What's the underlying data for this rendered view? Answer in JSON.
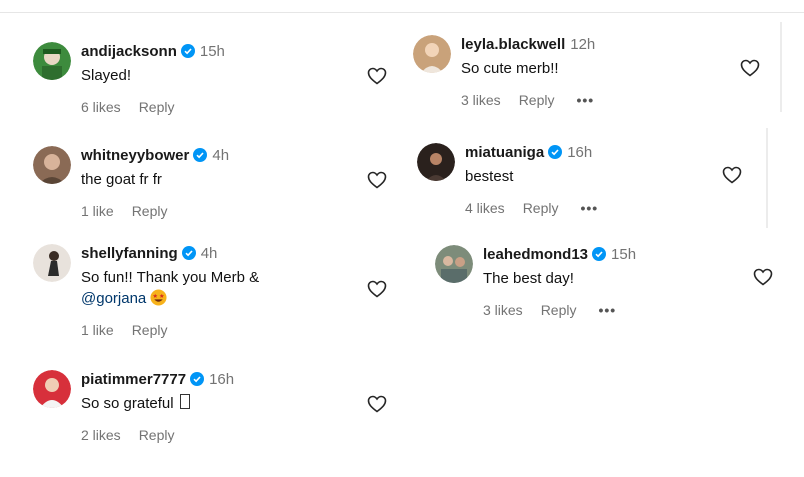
{
  "colors": {
    "verified_blue": "#0095f6",
    "meta_gray": "#737373",
    "mention": "#00376b"
  },
  "comments": [
    {
      "username": "andijacksonn",
      "verified": true,
      "time": "15h",
      "text": "Slayed!",
      "likes": "6 likes",
      "reply": "Reply"
    },
    {
      "username": "whitneyybower",
      "verified": true,
      "time": "4h",
      "text": "the goat fr fr",
      "likes": "1 like",
      "reply": "Reply"
    },
    {
      "username": "shellyfanning",
      "verified": true,
      "time": "4h",
      "text": "So fun!! Thank you Merb &",
      "mention": "@gorjana",
      "emoji": "star-struck-emoji",
      "likes": "1 like",
      "reply": "Reply"
    },
    {
      "username": "piatimmer7777",
      "verified": true,
      "time": "16h",
      "text": "So so grateful",
      "text_suffix": "unrendered-glyph-box",
      "likes": "2 likes",
      "reply": "Reply"
    },
    {
      "username": "leyla.blackwell",
      "verified": false,
      "time": "12h",
      "text": "So cute merb!!",
      "likes": "3 likes",
      "reply": "Reply",
      "more": "•••"
    },
    {
      "username": "miatuaniga",
      "verified": true,
      "time": "16h",
      "text": "bestest",
      "likes": "4 likes",
      "reply": "Reply",
      "more": "•••"
    },
    {
      "username": "leahedmond13",
      "verified": true,
      "time": "15h",
      "text": "The best day!",
      "likes": "3 likes",
      "reply": "Reply",
      "more": "•••"
    }
  ],
  "icons": {
    "like": "heart-outline-icon",
    "verified": "verified-badge-icon",
    "options": "more-options-icon"
  }
}
